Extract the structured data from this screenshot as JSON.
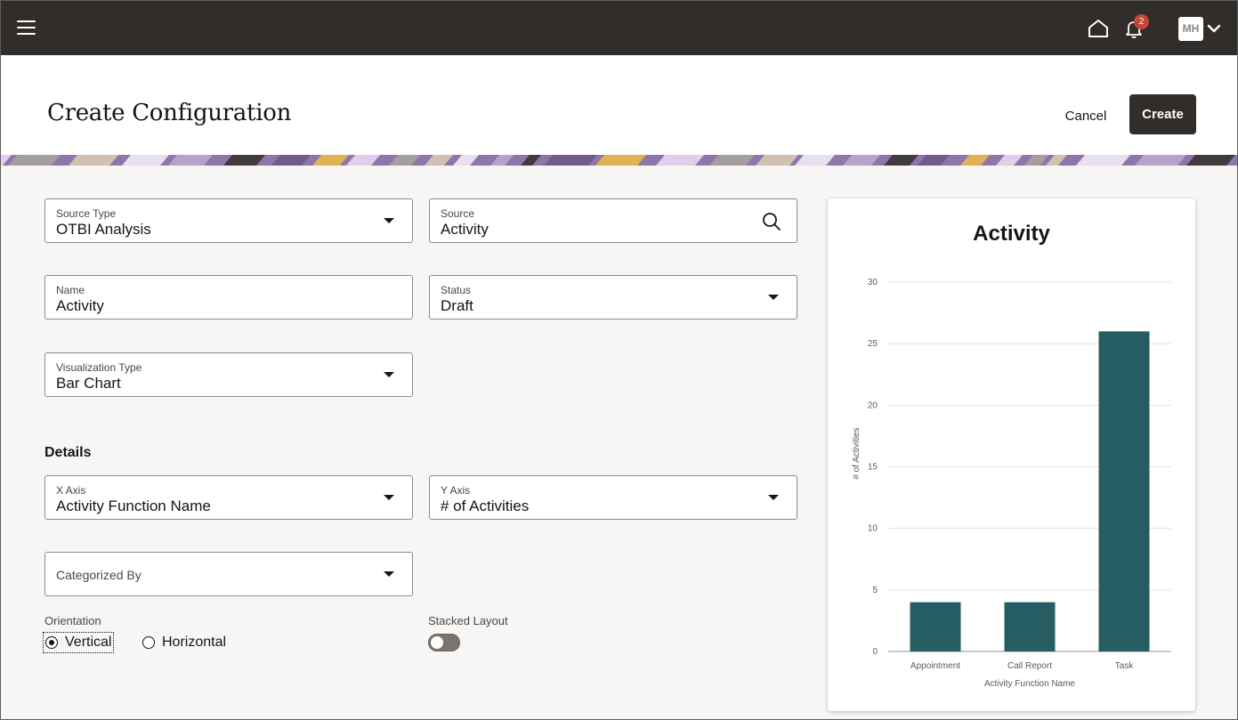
{
  "topbar": {
    "menu_icon": "hamburger-menu-icon",
    "home_icon": "home-icon",
    "notifications_icon": "bell-icon",
    "notification_count": "2",
    "avatar_initials": "MH",
    "user_menu_icon": "chevron-down-icon"
  },
  "header": {
    "title": "Create Configuration",
    "cancel_label": "Cancel",
    "create_label": "Create"
  },
  "form": {
    "source_type": {
      "label": "Source Type",
      "value": "OTBI Analysis"
    },
    "source": {
      "label": "Source",
      "value": "Activity"
    },
    "name": {
      "label": "Name",
      "value": "Activity"
    },
    "status": {
      "label": "Status",
      "value": "Draft"
    },
    "visualization_type": {
      "label": "Visualization Type",
      "value": "Bar Chart"
    },
    "details_title": "Details",
    "x_axis": {
      "label": "X Axis",
      "value": "Activity Function Name"
    },
    "y_axis": {
      "label": "Y Axis",
      "value": "# of Activities"
    },
    "categorized_by": {
      "label": "Categorized By",
      "value": ""
    },
    "orientation": {
      "label": "Orientation",
      "options": [
        "Vertical",
        "Horizontal"
      ],
      "selected": "Vertical"
    },
    "stacked_layout": {
      "label": "Stacked Layout",
      "on": false
    }
  },
  "chart_data": {
    "type": "bar",
    "title": "Activity",
    "categories": [
      "Appointment",
      "Call Report",
      "Task"
    ],
    "values": [
      4,
      4,
      26
    ],
    "xlabel": "Activity Function Name",
    "ylabel": "# of Activities",
    "ylim": [
      0,
      30
    ],
    "yticks": [
      0,
      5,
      10,
      15,
      20,
      25,
      30
    ],
    "bar_color": "#255d63",
    "grid": true
  }
}
